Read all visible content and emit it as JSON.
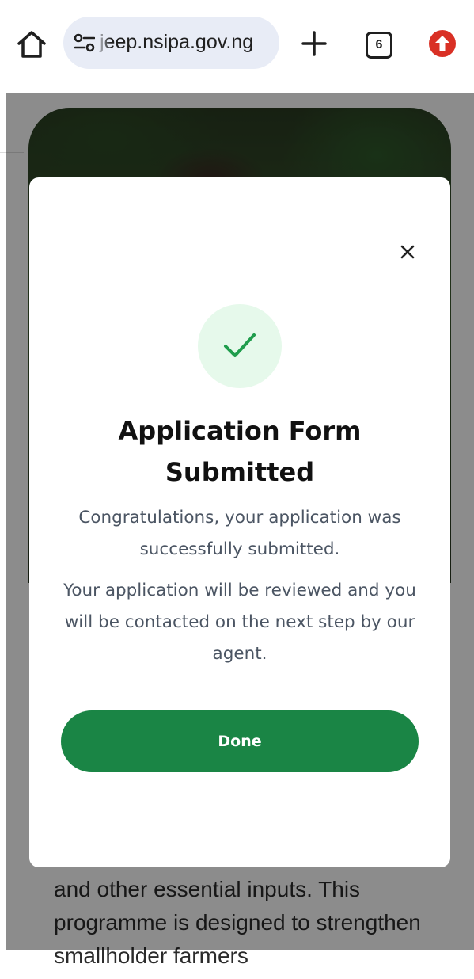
{
  "browser": {
    "url": "jeep.nsipa.gov.ng",
    "tab_count": "6"
  },
  "page": {
    "body_text": "and other essential inputs. This programme is designed to strengthen smallholder farmers"
  },
  "modal": {
    "title": "Application Form Submitted",
    "message_1": "Congratulations, your application was successfully submitted.",
    "message_2": "Your application will be reviewed and you will be contacted on the next step by our agent.",
    "done_label": "Done"
  },
  "icons": {
    "home": "home-icon",
    "site_settings": "tune-icon",
    "new_tab": "plus-icon",
    "tab_switcher": "tabs-icon",
    "update": "upload-arrow-icon",
    "close": "close-icon",
    "success": "check-icon"
  },
  "colors": {
    "accent_green": "#1a8545",
    "success_bg": "#e6f9eb",
    "check_green": "#1f9d4c",
    "update_red": "#d93025",
    "url_bar_bg": "#e8ecf6"
  }
}
